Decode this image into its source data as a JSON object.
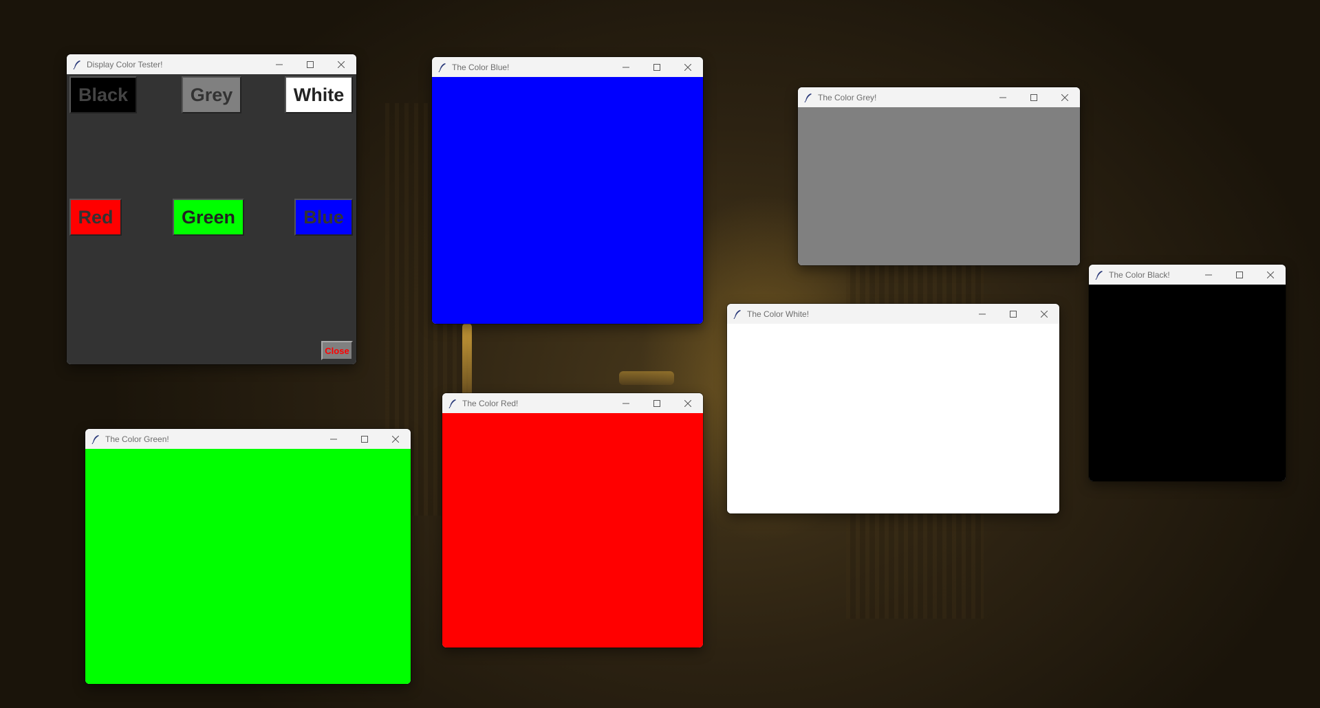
{
  "theme": {
    "titlebar_bg": "#f3f3f3",
    "title_color": "#6d6d6d",
    "tester_bg": "#333333"
  },
  "tester": {
    "title": "Display Color Tester!",
    "buttons": [
      {
        "label": "Black",
        "bg": "#000000",
        "fg": "#444444"
      },
      {
        "label": "Grey",
        "bg": "#808080",
        "fg": "#333333"
      },
      {
        "label": "White",
        "bg": "#ffffff",
        "fg": "#222222"
      },
      {
        "label": "Red",
        "bg": "#ff0000",
        "fg": "#333333"
      },
      {
        "label": "Green",
        "bg": "#00ff00",
        "fg": "#222222"
      },
      {
        "label": "Blue",
        "bg": "#0000ff",
        "fg": "#333333"
      }
    ],
    "close_label": "Close",
    "close_bg": "#808080",
    "close_fg": "#ff0000"
  },
  "color_windows": [
    {
      "id": "blue",
      "title": "The Color Blue!",
      "color": "#0000ff"
    },
    {
      "id": "grey",
      "title": "The Color Grey!",
      "color": "#808080"
    },
    {
      "id": "black",
      "title": "The Color Black!",
      "color": "#000000"
    },
    {
      "id": "white",
      "title": "The Color White!",
      "color": "#ffffff"
    },
    {
      "id": "red",
      "title": "The Color Red!",
      "color": "#ff0000"
    },
    {
      "id": "green",
      "title": "The Color Green!",
      "color": "#00ff00"
    }
  ],
  "window_controls": {
    "minimize_icon": "minimize-icon",
    "maximize_icon": "maximize-icon",
    "close_icon": "close-icon",
    "app_icon": "feather-icon"
  }
}
